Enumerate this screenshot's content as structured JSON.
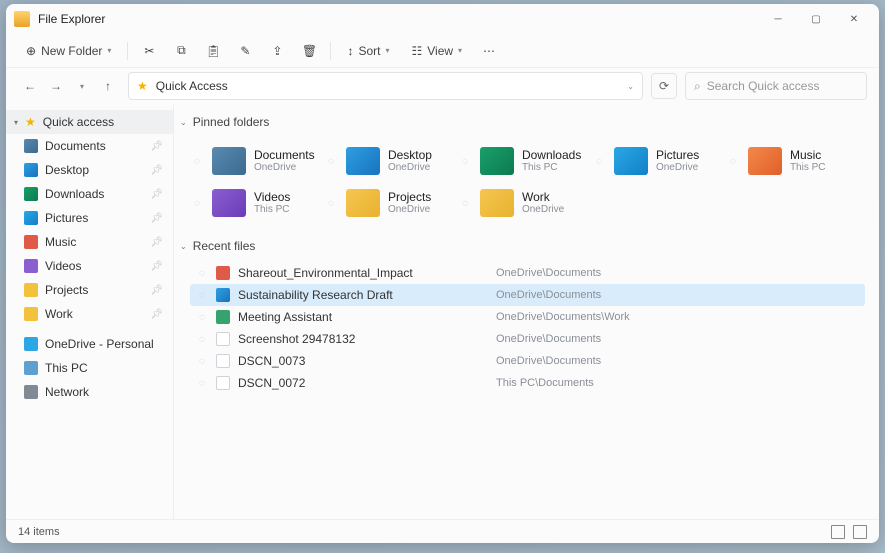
{
  "app_title": "File Explorer",
  "toolbar": {
    "new_folder": "New Folder",
    "sort": "Sort",
    "view": "View"
  },
  "address": {
    "path": "Quick Access"
  },
  "search": {
    "placeholder": "Search Quick access"
  },
  "sidebar": {
    "group1": "Quick access",
    "items1": [
      {
        "label": "Documents",
        "icoClass": "c-doc"
      },
      {
        "label": "Desktop",
        "icoClass": "c-desk"
      },
      {
        "label": "Downloads",
        "icoClass": "c-down"
      },
      {
        "label": "Pictures",
        "icoClass": "c-pic"
      },
      {
        "label": "Music",
        "icoClass": "c-red"
      },
      {
        "label": "Videos",
        "icoClass": "c-purple"
      },
      {
        "label": "Projects",
        "icoClass": "c-yellow"
      },
      {
        "label": "Work",
        "icoClass": "c-yellow"
      }
    ],
    "onedrive": "OneDrive - Personal",
    "thispc": "This PC",
    "network": "Network"
  },
  "sections": {
    "pinned": "Pinned folders",
    "recent": "Recent files"
  },
  "pinned": [
    {
      "name": "Documents",
      "loc": "OneDrive",
      "icoClass": "c-doc"
    },
    {
      "name": "Desktop",
      "loc": "OneDrive",
      "icoClass": "c-desk"
    },
    {
      "name": "Downloads",
      "loc": "This PC",
      "icoClass": "c-down"
    },
    {
      "name": "Pictures",
      "loc": "OneDrive",
      "icoClass": "c-pic"
    },
    {
      "name": "Music",
      "loc": "This PC",
      "icoClass": "c-mus"
    },
    {
      "name": "Videos",
      "loc": "This PC",
      "icoClass": "c-vid"
    },
    {
      "name": "Projects",
      "loc": "OneDrive",
      "icoClass": "c-proj"
    },
    {
      "name": "Work",
      "loc": "OneDrive",
      "icoClass": "c-work"
    }
  ],
  "recent": [
    {
      "name": "Shareout_Environmental_Impact",
      "loc": "OneDrive\\Documents",
      "icoClass": "c-red",
      "selected": false
    },
    {
      "name": "Sustainability Research Draft",
      "loc": "OneDrive\\Documents",
      "icoClass": "c-desk",
      "selected": true
    },
    {
      "name": "Meeting Assistant",
      "loc": "OneDrive\\Documents\\Work",
      "icoClass": "c-green",
      "selected": false
    },
    {
      "name": "Screenshot 29478132",
      "loc": "OneDrive\\Documents",
      "icoClass": "c-white",
      "selected": false
    },
    {
      "name": "DSCN_0073",
      "loc": "OneDrive\\Documents",
      "icoClass": "c-white",
      "selected": false
    },
    {
      "name": "DSCN_0072",
      "loc": "This PC\\Documents",
      "icoClass": "c-white",
      "selected": false
    }
  ],
  "status": {
    "count": "14 items"
  }
}
